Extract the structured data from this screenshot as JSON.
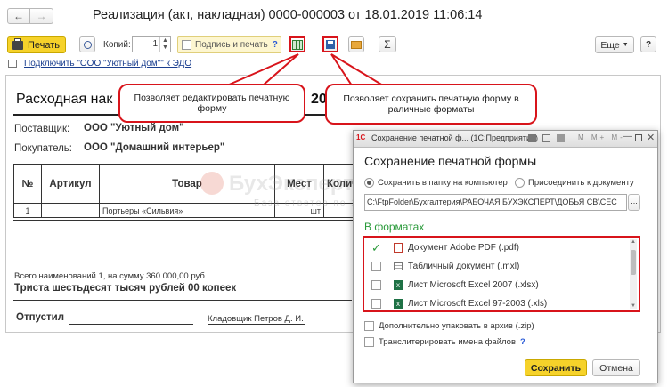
{
  "window": {
    "title": "Реализация (акт, накладная) 0000-000003 от 18.01.2019 11:06:14"
  },
  "toolbar": {
    "print_label": "Печать",
    "copies_label": "Копий:",
    "copies_value": "1",
    "sign_print_label": "Подпись и печать",
    "help_mark": "?",
    "more_label": "Еще",
    "sigma": "Σ"
  },
  "edo_link": "Подключить \"ООО \"Уютный дом\"\" к ЭДО",
  "document": {
    "title": "Расходная нак",
    "title_tail": "20",
    "supplier_label": "Поставщик:",
    "supplier_value": "ООО \"Уютный дом\"",
    "buyer_label": "Покупатель:",
    "buyer_value": "ООО \"Домашний интерьер\"",
    "columns": [
      "№",
      "Артикул",
      "Товар",
      "Мест",
      "Колич"
    ],
    "rows": [
      {
        "num": "1",
        "article": "",
        "item": "Портьеры «Сильвия»",
        "places": "шт"
      }
    ],
    "total_line": "Всего наименований 1, на сумму 360 000,00 руб.",
    "total_words": "Триста шестьдесят тысяч рублей 00 копеек",
    "released_label": "Отпустил",
    "storekeeper": "Кладовщик Петров Д. И."
  },
  "watermark": {
    "main": "БухЭксперт8",
    "sub": "База ответов по 1С"
  },
  "callouts": {
    "edit": "Позволяет редактировать печатную форму",
    "save": "Позволяет сохранить печатную форму в раличные форматы"
  },
  "dialog": {
    "window_title": "Сохранение печатной ф... (1С:Предприятие)",
    "heading": "Сохранение печатной формы",
    "opt_folder": "Сохранить в папку на компьютер",
    "opt_attach": "Присоединить к документу",
    "path": "C:\\FtpFolder\\Бухгалтерия\\РАБОЧАЯ БУХЭКСПЕРТ\\ДОБЬЯ СВ\\СЕС",
    "formats_label": "В форматах",
    "formats": [
      {
        "label": "Документ Adobe PDF (.pdf)",
        "checked": true,
        "icon": "pdf-icon"
      },
      {
        "label": "Табличный документ (.mxl)",
        "checked": false,
        "icon": "mxl-icon"
      },
      {
        "label": "Лист Microsoft Excel 2007 (.xlsx)",
        "checked": false,
        "icon": "excel-icon"
      },
      {
        "label": "Лист Microsoft Excel 97-2003 (.xls)",
        "checked": false,
        "icon": "excel-icon"
      }
    ],
    "zip_label": "Дополнительно упаковать в архив (.zip)",
    "translit_label": "Транслитерировать имена файлов",
    "help_mark": "?",
    "save_button": "Сохранить",
    "cancel_button": "Отмена"
  },
  "colors": {
    "accent_yellow": "#f6d22a",
    "callout_red": "#d8141b",
    "link_blue": "#1a3e8f",
    "formats_green": "#2a9a3a"
  }
}
